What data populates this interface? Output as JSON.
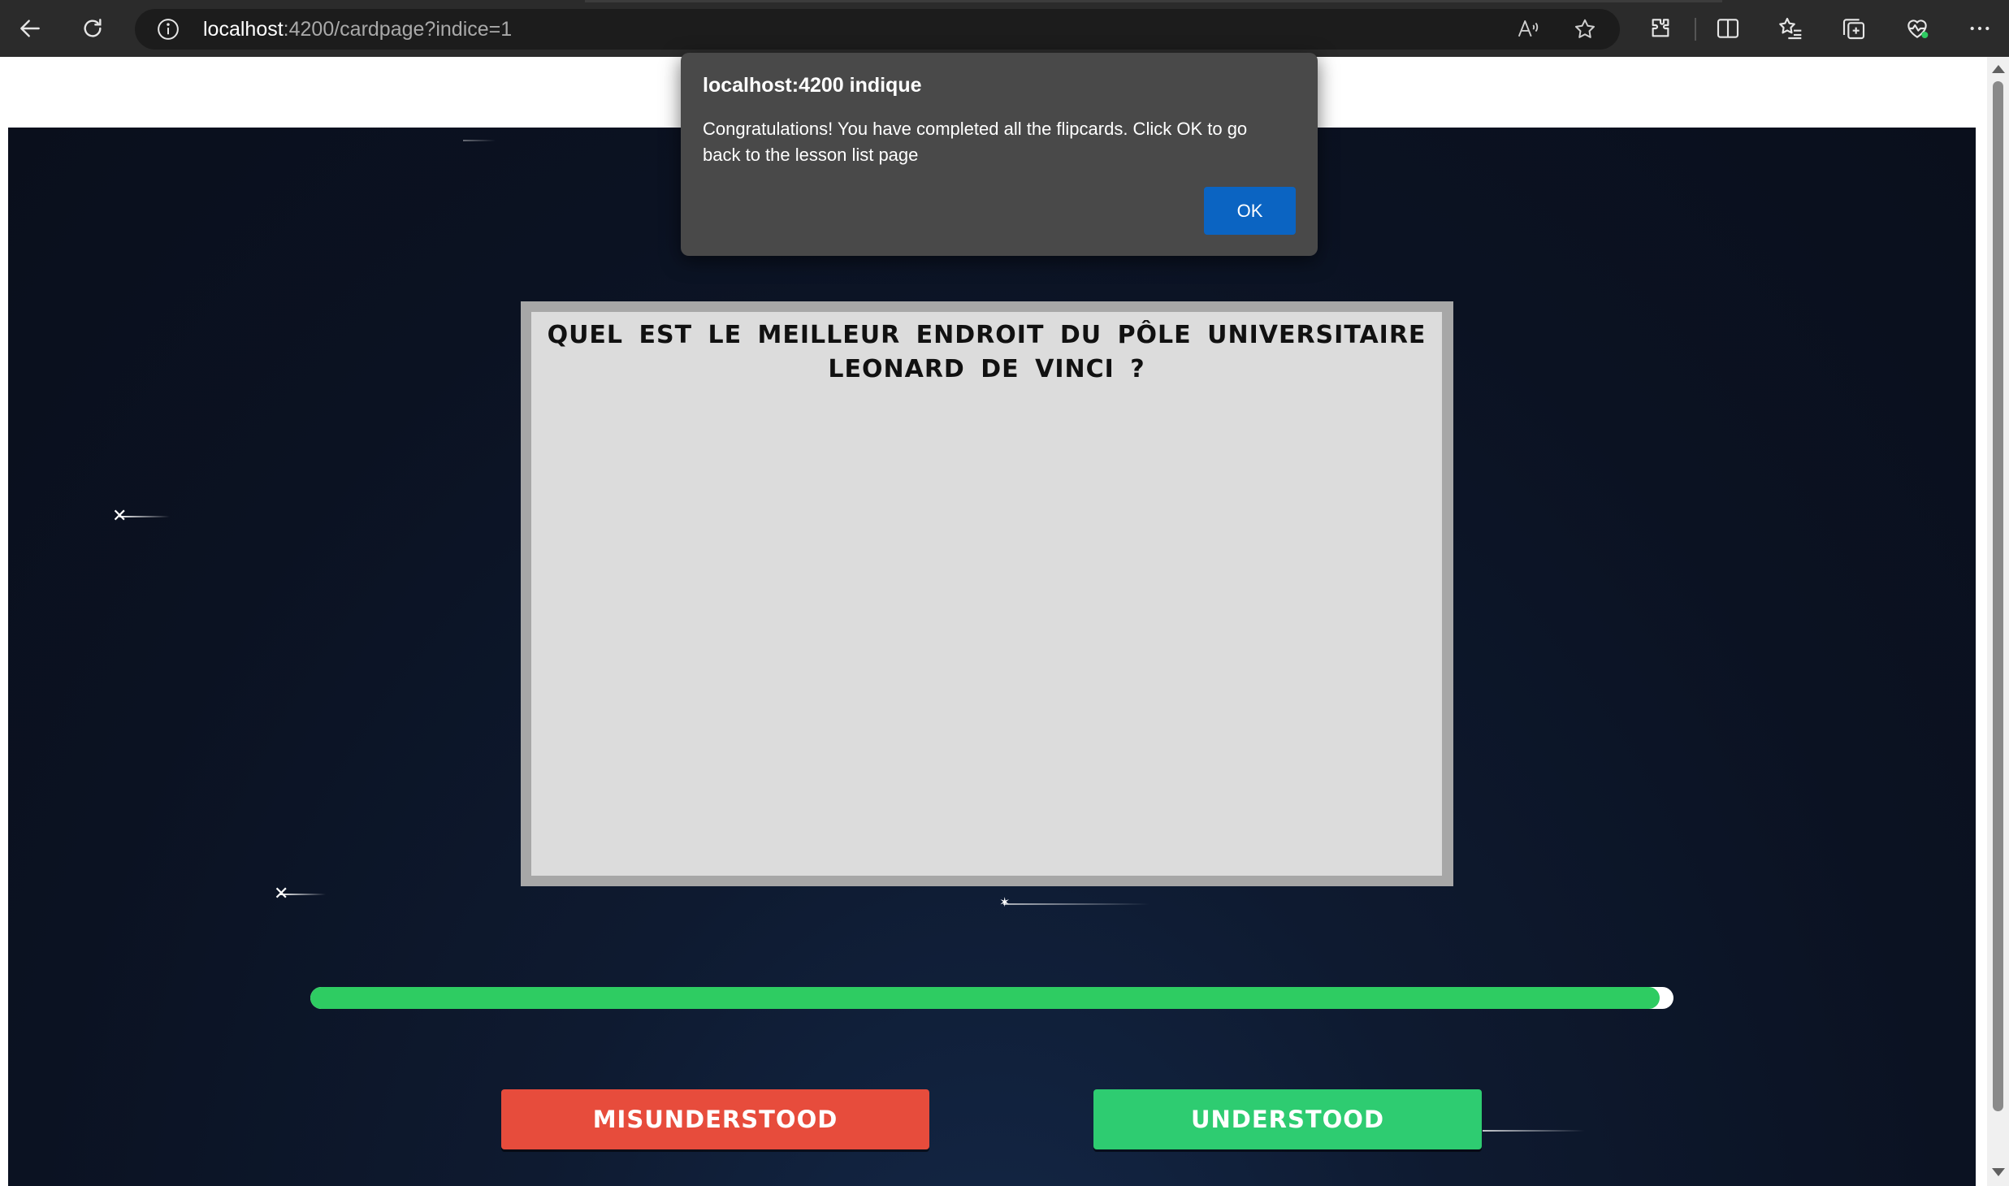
{
  "browser": {
    "url_host": "localhost",
    "url_rest": ":4200/cardpage?indice=1",
    "icons": [
      "back-icon",
      "refresh-icon",
      "info-icon",
      "read-aloud-icon",
      "favorite-star-icon",
      "extensions-icon",
      "split-screen-icon",
      "favorites-icon",
      "collections-icon",
      "browser-essentials-icon",
      "more-icon"
    ]
  },
  "dialog": {
    "title": "localhost:4200 indique",
    "message": "Congratulations! You have completed all the flipcards. Click OK to go back to the lesson list page",
    "ok_label": "OK"
  },
  "card": {
    "question": "Quel est le meilleur endroit du pôle universitaire Leonard de Vinci ?"
  },
  "progress": {
    "percent": 99
  },
  "buttons": {
    "misunderstood_label": "Misunderstood",
    "understood_label": "Understood"
  },
  "colors": {
    "background": "#0b1222",
    "misunderstood": "#e74c3c",
    "understood": "#2ecc71",
    "progress": "#2ecc62",
    "dialog_ok": "#0b64c2"
  }
}
